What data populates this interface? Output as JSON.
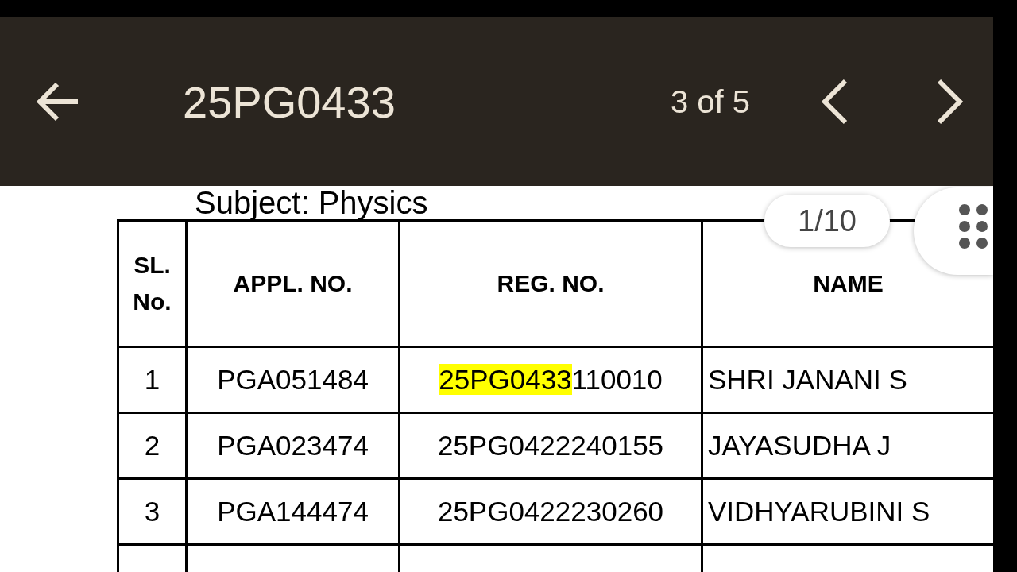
{
  "toolbar": {
    "query": "25PG0433",
    "match_count": "3 of 5"
  },
  "document": {
    "subject": "Subject: Physics",
    "table": {
      "columns": [
        "SL. No.",
        "APPL. NO.",
        "REG. NO.",
        "NAME"
      ],
      "rows": [
        {
          "sl": "1",
          "appl_no": "PGA051484",
          "reg_no_parts": [
            {
              "text": "25PG0433",
              "highlighted": true
            },
            {
              "text": "110010",
              "highlighted": false
            }
          ],
          "name": "SHRI JANANI S"
        },
        {
          "sl": "2",
          "appl_no": "PGA023474",
          "reg_no_parts": [
            {
              "text": "25PG0422240155",
              "highlighted": false
            }
          ],
          "name": "JAYASUDHA J"
        },
        {
          "sl": "3",
          "appl_no": "PGA144474",
          "reg_no_parts": [
            {
              "text": "25PG0422230260",
              "highlighted": false
            }
          ],
          "name": "VIDHYARUBINI S"
        }
      ]
    }
  },
  "page_indicator": "1/10"
}
